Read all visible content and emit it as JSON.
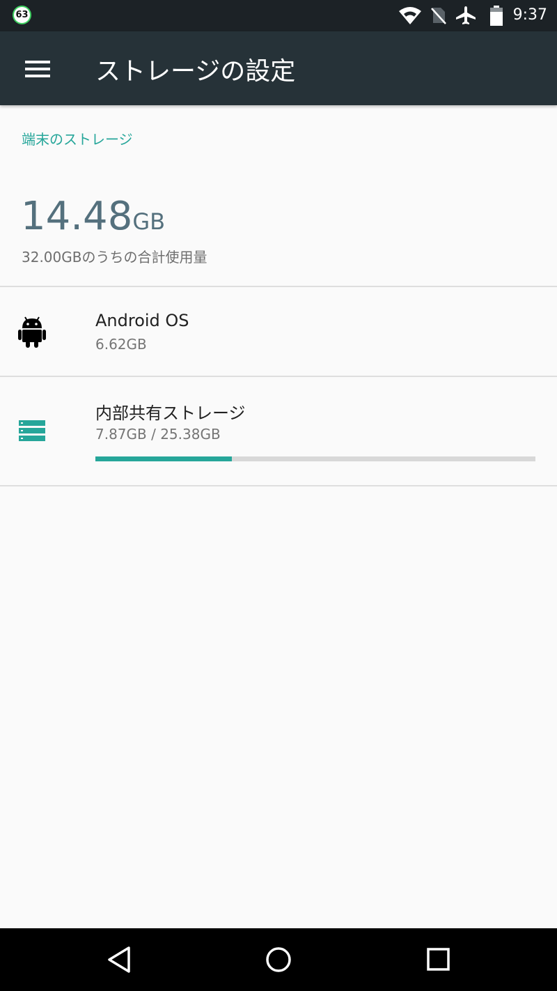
{
  "status_bar": {
    "badge": "63",
    "time": "9:37",
    "icons": [
      "wifi-icon",
      "no-sim-icon",
      "airplane-icon",
      "battery-icon"
    ]
  },
  "app_bar": {
    "title": "ストレージの設定",
    "menu_icon": "menu-icon"
  },
  "device_storage": {
    "section_header": "端末のストレージ",
    "total_used_value": "14.48",
    "total_used_unit": "GB",
    "total_description": "32.00GBのうちの合計使用量"
  },
  "items": [
    {
      "icon": "android-icon",
      "title": "Android OS",
      "subtitle": "6.62GB"
    },
    {
      "icon": "storage-icon",
      "title": "内部共有ストレージ",
      "subtitle": "7.87GB / 25.38GB",
      "usage_fraction": 0.31
    }
  ],
  "nav_bar": {
    "buttons": [
      "back-icon",
      "home-icon",
      "recents-icon"
    ]
  },
  "colors": {
    "accent": "#26a69a",
    "app_bar": "#263238",
    "status_bar": "#1c2226",
    "background": "#fafafa"
  }
}
